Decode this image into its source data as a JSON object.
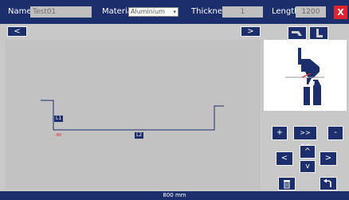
{
  "header": {
    "name_label": "Name",
    "name_value": "Test01",
    "material_label": "Material",
    "material_value": "Aluminium",
    "thickness_label": "Thickness",
    "thickness_value": "1",
    "length_label": "Length",
    "length_value": "1200",
    "close_label": "X"
  },
  "nav": {
    "prev_label": "<",
    "next_label": ">"
  },
  "drawing": {
    "tag_l1": "L1",
    "tag_l2": "L2",
    "red_mark": "-90",
    "width_label": "800  mm"
  },
  "controls": {
    "plus_label": "+",
    "swap_label": ">> <<",
    "minus_label": "-",
    "up_label": "^",
    "left_label": "<",
    "right_label": ">",
    "down_label": "v"
  },
  "colors": {
    "navy": "#1c2e6c",
    "red": "#e0252a",
    "panel": "#c8c8c8"
  }
}
